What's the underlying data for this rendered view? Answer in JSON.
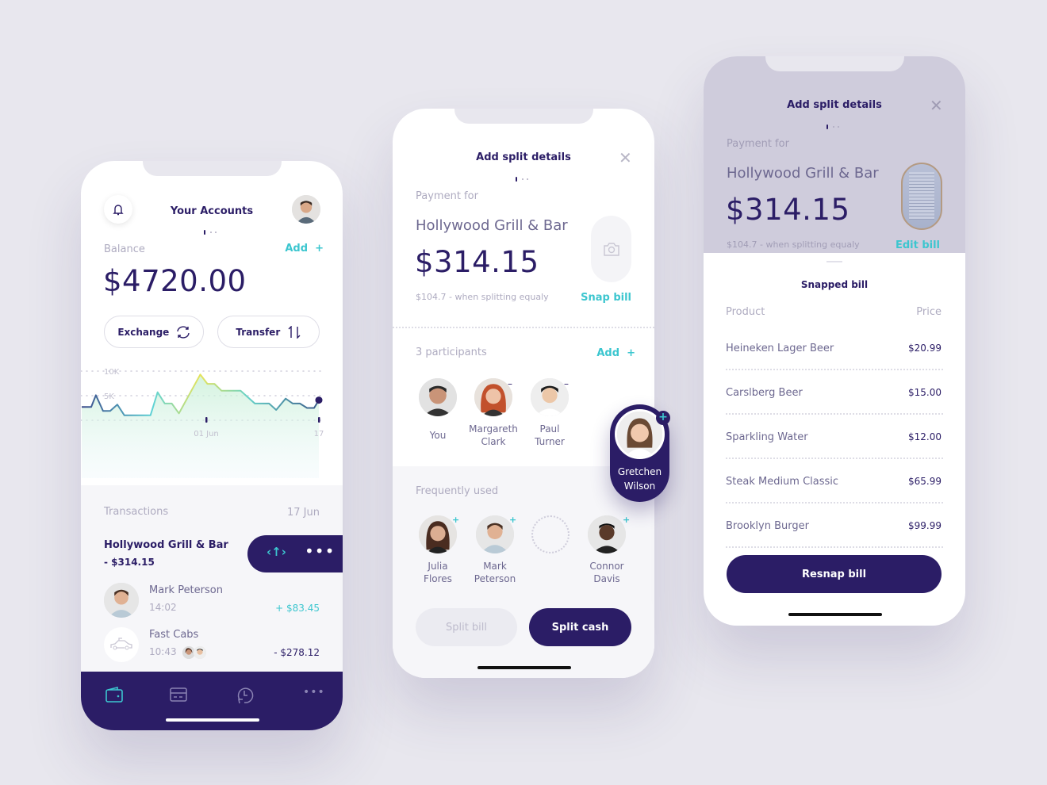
{
  "colors": {
    "primary": "#2b1d66",
    "accent": "#3cc6cf",
    "muted": "#aeabc0",
    "background": "#e8e7ee"
  },
  "accounts": {
    "title": "Your Accounts",
    "balance_label": "Balance",
    "add_label": "Add",
    "add_icon": "+",
    "balance": "$4720.00",
    "exchange_label": "Exchange",
    "transfer_label": "Transfer",
    "transactions_label": "Transactions",
    "transactions_date": "17 Jun",
    "selected_transaction": {
      "name": "Hollywood Grill & Bar",
      "amount": "- $314.15"
    },
    "transactions": [
      {
        "name": "Mark Peterson",
        "time": "14:02",
        "amount": "+ $83.45",
        "icon": "avatar"
      },
      {
        "name": "Fast Cabs",
        "time": "10:43",
        "amount": "- $278.12",
        "icon": "car-icon"
      }
    ],
    "nav": [
      "wallet-icon",
      "card-icon",
      "history-icon",
      "more-icon"
    ]
  },
  "chart_data": {
    "type": "area",
    "title": "",
    "xlabel": "",
    "ylabel": "",
    "ylim": [
      0,
      10
    ],
    "y_ticks": [
      "10K",
      "5K"
    ],
    "x_ticks": [
      "01 Jun",
      "17"
    ],
    "grid": true,
    "values": [
      2.7,
      2.7,
      5.1,
      1.9,
      1.9,
      3.2,
      1.0,
      1.0,
      5.7,
      3.4,
      3.4,
      1.4,
      9.3,
      7.4,
      7.4,
      6.0,
      6.0,
      3.4,
      3.4,
      2.1,
      4.4,
      3.4,
      3.4,
      2.5,
      2.5,
      4.1
    ],
    "x_positions": [
      0,
      4,
      6,
      9,
      12,
      15,
      18,
      29,
      32,
      35,
      38,
      41,
      50,
      53,
      56,
      59,
      67,
      73,
      79,
      82,
      86,
      89,
      92,
      95,
      98,
      100
    ]
  },
  "split": {
    "title": "Add split details",
    "payment_for_label": "Payment for",
    "merchant": "Hollywood Grill & Bar",
    "amount": "$314.15",
    "split_note": "$104.7 - when splitting equaly",
    "snap_label": "Snap bill",
    "participants_label": "3 participants",
    "add_label": "Add",
    "participants": [
      {
        "first": "You",
        "last": ""
      },
      {
        "first": "Margareth",
        "last": "Clark"
      },
      {
        "first": "Paul",
        "last": "Turner"
      }
    ],
    "dragged": {
      "first": "Gretchen",
      "last": "Wilson"
    },
    "frequent_label": "Frequently used",
    "frequent": [
      {
        "first": "Julia",
        "last": "Flores"
      },
      {
        "first": "Mark",
        "last": "Peterson"
      },
      {
        "first": "Connor",
        "last": "Davis"
      }
    ],
    "split_bill_label": "Split bill",
    "split_cash_label": "Split cash"
  },
  "snapped": {
    "title": "Add split details",
    "payment_for_label": "Payment for",
    "merchant": "Hollywood Grill & Bar",
    "amount": "$314.15",
    "split_note": "$104.7 - when splitting equaly",
    "edit_label": "Edit bill",
    "sheet_title": "Snapped bill",
    "product_header": "Product",
    "price_header": "Price",
    "items": [
      {
        "product": "Heineken Lager Beer",
        "price": "$20.99"
      },
      {
        "product": "Carslberg Beer",
        "price": "$15.00"
      },
      {
        "product": "Sparkling Water",
        "price": "$12.00"
      },
      {
        "product": "Steak Medium Classic",
        "price": "$65.99"
      },
      {
        "product": "Brooklyn Burger",
        "price": "$99.99"
      }
    ],
    "resnap_label": "Resnap bill"
  }
}
